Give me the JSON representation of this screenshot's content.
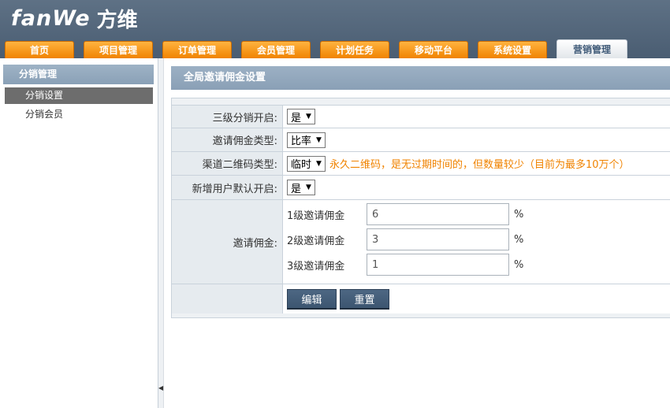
{
  "app": {
    "logo_text": "fanWe",
    "logo_cn": "方维"
  },
  "nav": {
    "tabs": [
      {
        "label": "首页",
        "active": false
      },
      {
        "label": "项目管理",
        "active": false
      },
      {
        "label": "订单管理",
        "active": false
      },
      {
        "label": "会员管理",
        "active": false
      },
      {
        "label": "计划任务",
        "active": false
      },
      {
        "label": "移动平台",
        "active": false
      },
      {
        "label": "系统设置",
        "active": false
      },
      {
        "label": "营销管理",
        "active": true
      }
    ]
  },
  "sidebar": {
    "header": "分销管理",
    "items": [
      {
        "label": "分销设置",
        "active": true
      },
      {
        "label": "分销会员",
        "active": false
      }
    ]
  },
  "panel": {
    "title": "全局邀请佣金设置"
  },
  "form": {
    "rows": [
      {
        "label": "三级分销开启:",
        "value": "是"
      },
      {
        "label": "邀请佣金类型:",
        "value": "比率"
      },
      {
        "label": "渠道二维码类型:",
        "value": "临时",
        "hint": "永久二维码，是无过期时间的，但数量较少（目前为最多10万个）"
      },
      {
        "label": "新增用户默认开启:",
        "value": "是"
      }
    ],
    "commission": {
      "label": "邀请佣金:",
      "levels": [
        {
          "label": "1级邀请佣金",
          "value": "6",
          "unit": "%"
        },
        {
          "label": "2级邀请佣金",
          "value": "3",
          "unit": "%"
        },
        {
          "label": "3级邀请佣金",
          "value": "1",
          "unit": "%"
        }
      ]
    },
    "buttons": {
      "edit": "编辑",
      "reset": "重置"
    }
  },
  "colors": {
    "header_bg": "#4a5d72",
    "tab_orange": "#f08300",
    "hint": "#f08300",
    "button": "#3c5570"
  }
}
